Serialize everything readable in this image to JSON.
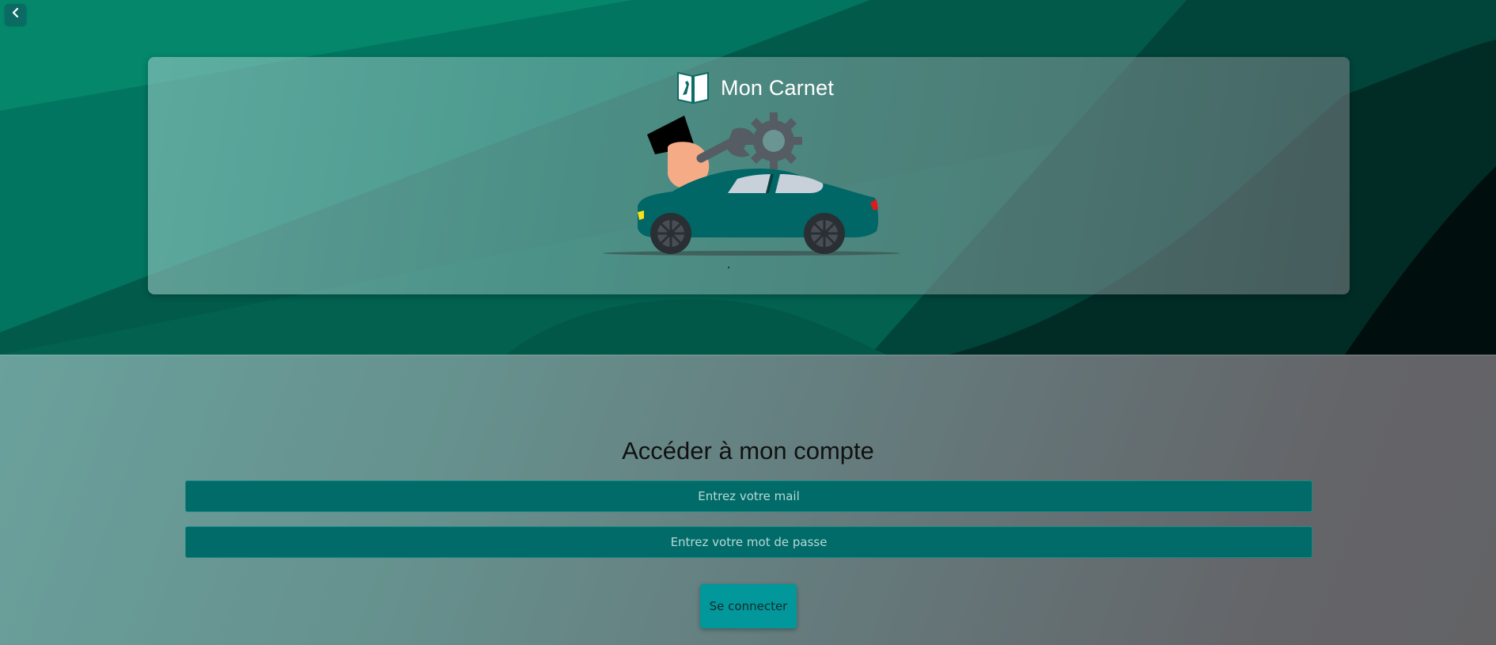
{
  "app": {
    "brand_name": "Mon Carnet"
  },
  "icons": {
    "back": "chevron-left-icon",
    "logo": "open-book-wrench-icon"
  },
  "login": {
    "title": "Accéder à mon compte",
    "email_placeholder": "Entrez votre mail",
    "password_placeholder": "Entrez votre mot de passe",
    "submit_label": "Se connecter"
  },
  "colors": {
    "accent": "#02979a",
    "field_bg": "#006b69",
    "hero_dark": "#004c40",
    "car_body": "#006666"
  }
}
